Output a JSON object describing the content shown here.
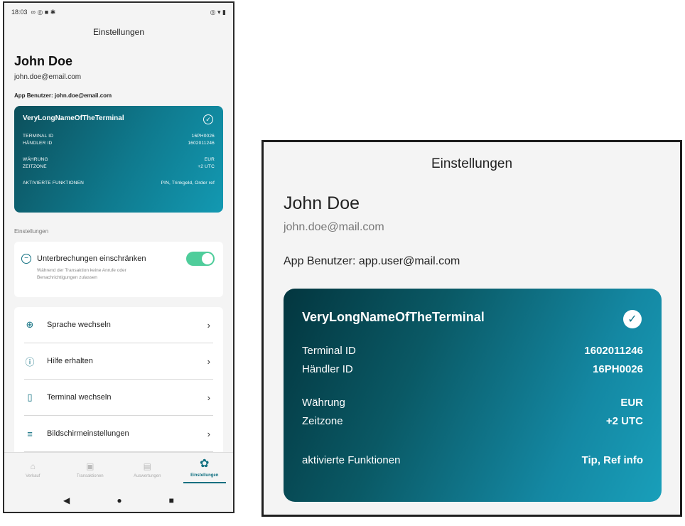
{
  "phone": {
    "status_time": "18:03",
    "title": "Einstellungen",
    "user_name": "John Doe",
    "user_email": "john.doe@email.com",
    "app_user": "App Benutzer: john.doe@email.com",
    "card": {
      "terminal_name": "VeryLongNameOfTheTerminal",
      "terminal_id_label": "TERMINAL ID",
      "terminal_id_value": "16PH0026",
      "merchant_id_label": "HÄNDLER ID",
      "merchant_id_value": "1602011246",
      "currency_label": "WÄHRUNG",
      "currency_value": "EUR",
      "timezone_label": "ZEITZONE",
      "timezone_value": "+2 UTC",
      "features_label": "AKTIVIERTE FUNKTIONEN",
      "features_value": "PIN, Trinkgeld, Order ref"
    },
    "section_label": "Einstellungen",
    "toggle": {
      "title": "Unterbrechungen einschränken",
      "description": "Während der Transaktion keine Anrufe oder Benachrichtigungen zulassen",
      "enabled": true
    },
    "menu_items": [
      {
        "label": "Sprache wechseln",
        "icon": "globe-icon"
      },
      {
        "label": "Hilfe erhalten",
        "icon": "help-icon"
      },
      {
        "label": "Terminal wechseln",
        "icon": "terminal-icon"
      },
      {
        "label": "Bildschirmeinstellungen",
        "icon": "settings-sliders-icon"
      }
    ],
    "nav": [
      {
        "label": "Verkauf",
        "icon": "home-icon"
      },
      {
        "label": "Transaktionen",
        "icon": "transactions-icon"
      },
      {
        "label": "Auswertungen",
        "icon": "reports-icon"
      },
      {
        "label": "Einstellungen",
        "icon": "gear-icon",
        "active": true
      }
    ]
  },
  "zoom": {
    "title": "Einstellungen",
    "user_name": "John Doe",
    "user_email": "john.doe@mail.com",
    "app_user": "App Benutzer: app.user@mail.com",
    "card": {
      "terminal_name": "VeryLongNameOfTheTerminal",
      "terminal_id_label": "Terminal ID",
      "terminal_id_value": "1602011246",
      "merchant_id_label": "Händler ID",
      "merchant_id_value": "16PH0026",
      "currency_label": "Währung",
      "currency_value": "EUR",
      "timezone_label": "Zeitzone",
      "timezone_value": "+2 UTC",
      "features_label": "aktivierte Funktionen",
      "features_value": "Tip, Ref info"
    }
  },
  "colors": {
    "accent": "#0f6f80",
    "toggle_on": "#4fcd9b",
    "background": "#f4f4f4"
  }
}
